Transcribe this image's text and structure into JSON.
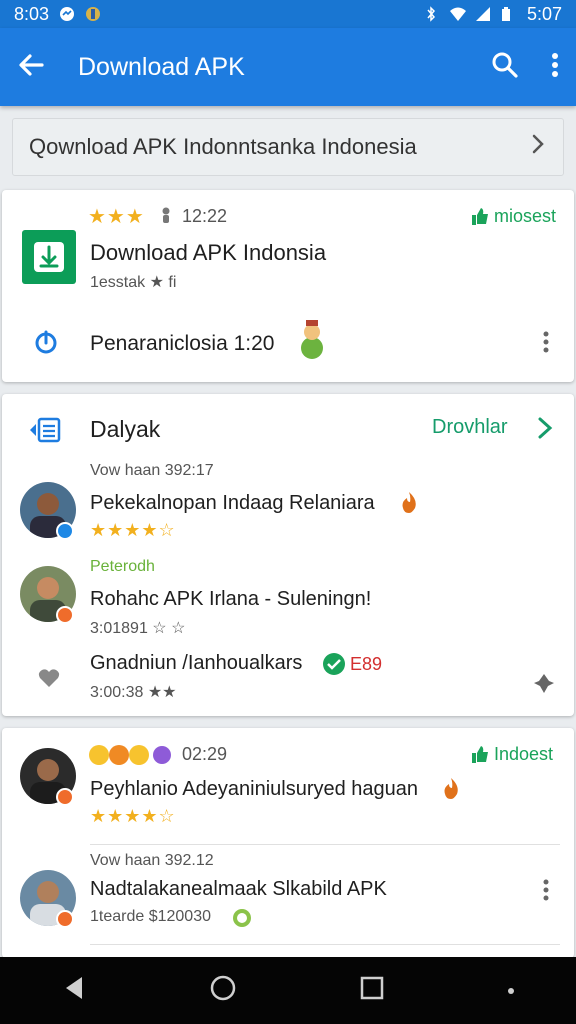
{
  "status_bar": {
    "time_left": "8:03",
    "time_right": "5:07"
  },
  "app_bar": {
    "title": "Download APK"
  },
  "search": {
    "text": "Qownload APK Indonntsanka Indonesia"
  },
  "card1": {
    "time": "12:22",
    "tag": "miosest",
    "app_title": "Download APK Indonsia",
    "app_subtitle": "1esstak ★ fi",
    "action_text": "Penaraniclosia 1:20"
  },
  "card2": {
    "header": "Dalyak",
    "header_action": "Drovhlar",
    "rows": [
      {
        "meta": "Vow haan 392:17",
        "title": "Pekekalnopan Indaag Relaniara",
        "stars": "★★★★☆"
      },
      {
        "meta": "Peterodh",
        "title": "Rohahc APK Irlana - Suleningn!",
        "sub": "3:01891 ☆ ☆"
      },
      {
        "title": "Gnadniun /Ianhoualkars",
        "badge": "E89",
        "sub": "3:00:38 ★★"
      }
    ]
  },
  "card3": {
    "time": "02:29",
    "tag": "Indoest",
    "rows": [
      {
        "title": "Peyhlanio Adeyaniniulsuryed haguan",
        "stars": "★★★★☆"
      },
      {
        "meta": "Vow haan 392.12",
        "title": "Nadtalakanealmaak Slkabild APK",
        "sub": "1tearde $120030"
      }
    ]
  },
  "colors": {
    "app_bar": "#1e7ce0",
    "accent_green": "#1aa35a",
    "star": "#f2b01e"
  }
}
